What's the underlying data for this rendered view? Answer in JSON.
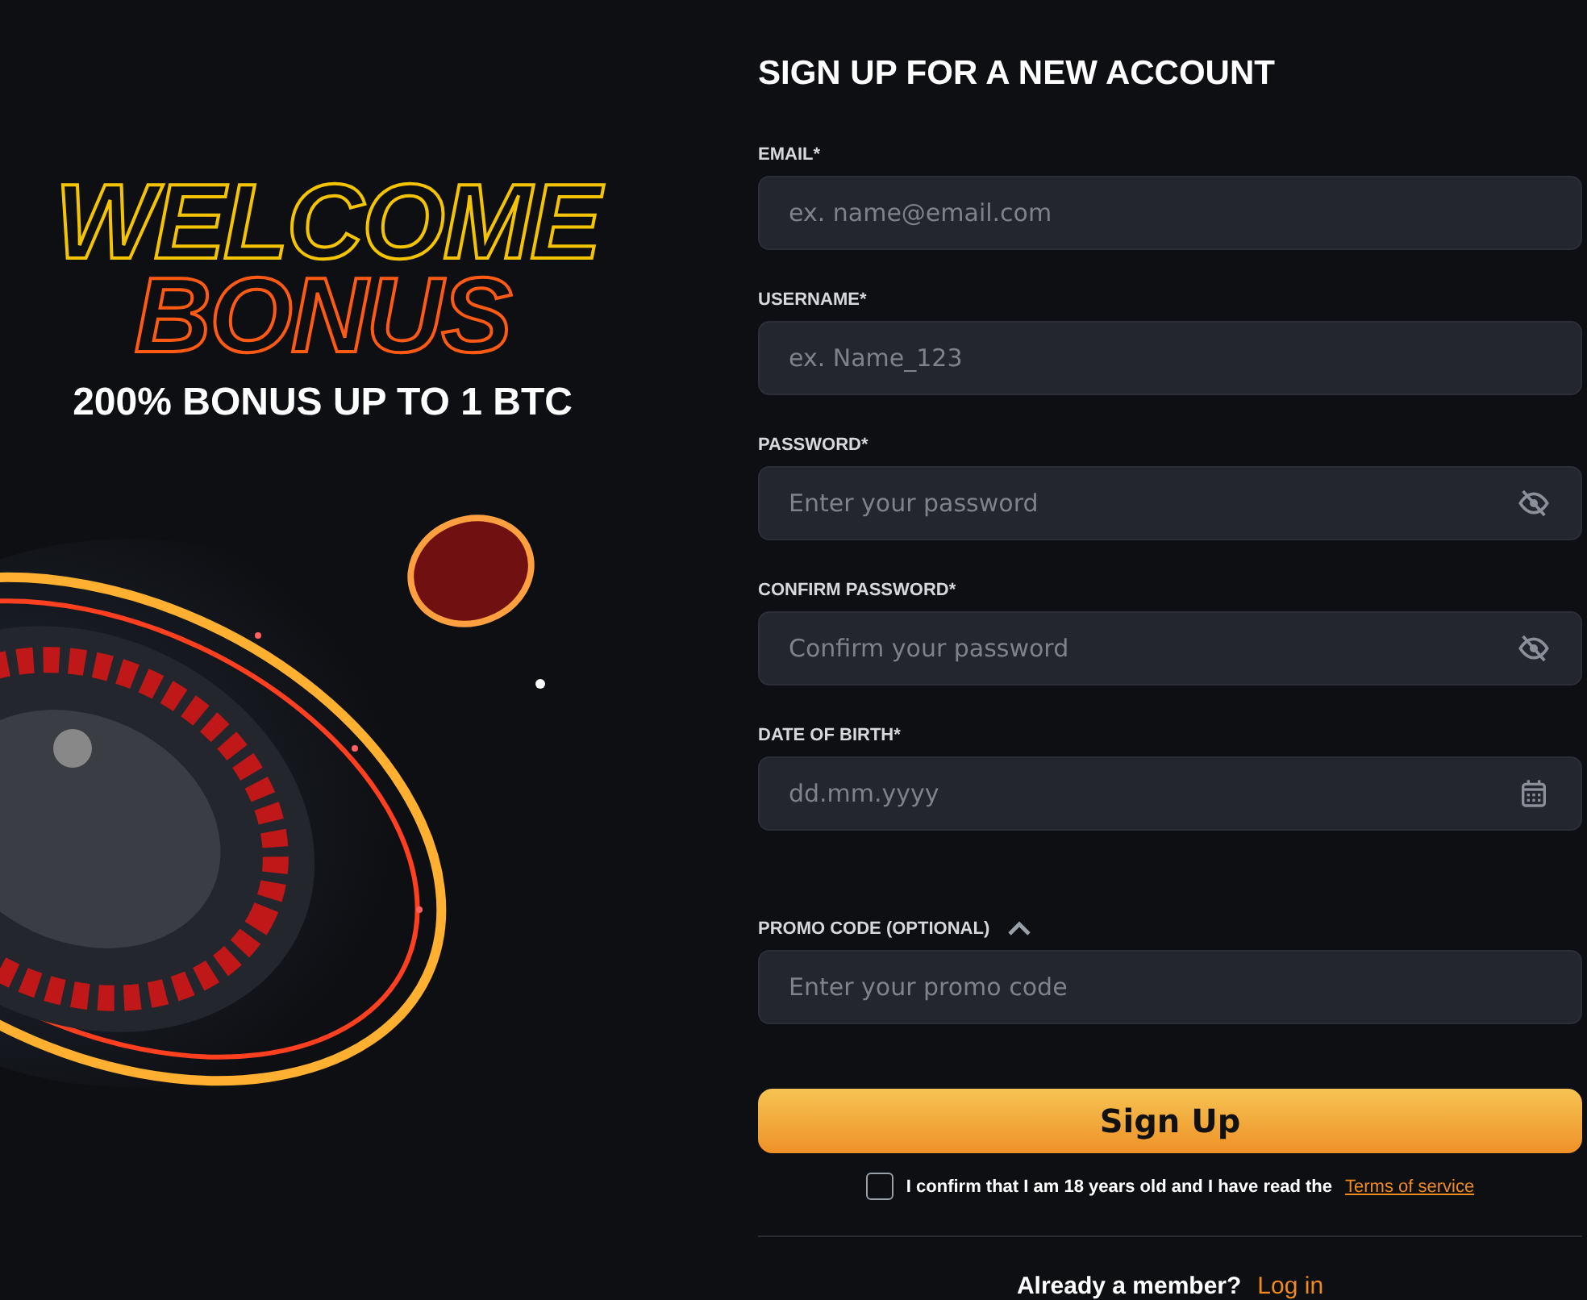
{
  "promo": {
    "headline_1": "WELCOME",
    "headline_2": "BONUS",
    "offer": "200% BONUS UP TO 1 BTC"
  },
  "form": {
    "title": "SIGN UP FOR A NEW ACCOUNT",
    "fields": [
      {
        "kind": "text",
        "label": "EMAIL*",
        "placeholder": "ex. name@email.com"
      },
      {
        "kind": "text",
        "label": "USERNAME*",
        "placeholder": "ex. Name_123"
      },
      {
        "kind": "password",
        "label": "PASSWORD*",
        "placeholder": "Enter your password"
      },
      {
        "kind": "password",
        "label": "CONFIRM PASSWORD*",
        "placeholder": "Confirm your password"
      },
      {
        "kind": "date",
        "label": "DATE OF BIRTH*",
        "placeholder": "dd.mm.yyyy"
      }
    ],
    "promo_code": {
      "label": "PROMO CODE (OPTIONAL)",
      "expanded": true,
      "placeholder": "Enter your promo code"
    },
    "submit": "Sign Up",
    "consent": {
      "checked": false,
      "text": "I confirm that I am 18 years old and I have read the",
      "link": "Terms of service"
    },
    "footer": {
      "text": "Already a member?",
      "link": "Log in"
    }
  }
}
